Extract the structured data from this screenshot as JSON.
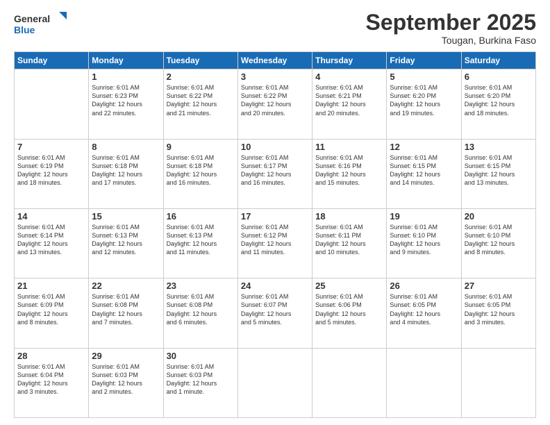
{
  "header": {
    "logo_line1": "General",
    "logo_line2": "Blue",
    "month": "September 2025",
    "location": "Tougan, Burkina Faso"
  },
  "weekdays": [
    "Sunday",
    "Monday",
    "Tuesday",
    "Wednesday",
    "Thursday",
    "Friday",
    "Saturday"
  ],
  "weeks": [
    [
      {
        "day": "",
        "info": ""
      },
      {
        "day": "1",
        "info": "Sunrise: 6:01 AM\nSunset: 6:23 PM\nDaylight: 12 hours\nand 22 minutes."
      },
      {
        "day": "2",
        "info": "Sunrise: 6:01 AM\nSunset: 6:22 PM\nDaylight: 12 hours\nand 21 minutes."
      },
      {
        "day": "3",
        "info": "Sunrise: 6:01 AM\nSunset: 6:22 PM\nDaylight: 12 hours\nand 20 minutes."
      },
      {
        "day": "4",
        "info": "Sunrise: 6:01 AM\nSunset: 6:21 PM\nDaylight: 12 hours\nand 20 minutes."
      },
      {
        "day": "5",
        "info": "Sunrise: 6:01 AM\nSunset: 6:20 PM\nDaylight: 12 hours\nand 19 minutes."
      },
      {
        "day": "6",
        "info": "Sunrise: 6:01 AM\nSunset: 6:20 PM\nDaylight: 12 hours\nand 18 minutes."
      }
    ],
    [
      {
        "day": "7",
        "info": "Sunrise: 6:01 AM\nSunset: 6:19 PM\nDaylight: 12 hours\nand 18 minutes."
      },
      {
        "day": "8",
        "info": "Sunrise: 6:01 AM\nSunset: 6:18 PM\nDaylight: 12 hours\nand 17 minutes."
      },
      {
        "day": "9",
        "info": "Sunrise: 6:01 AM\nSunset: 6:18 PM\nDaylight: 12 hours\nand 16 minutes."
      },
      {
        "day": "10",
        "info": "Sunrise: 6:01 AM\nSunset: 6:17 PM\nDaylight: 12 hours\nand 16 minutes."
      },
      {
        "day": "11",
        "info": "Sunrise: 6:01 AM\nSunset: 6:16 PM\nDaylight: 12 hours\nand 15 minutes."
      },
      {
        "day": "12",
        "info": "Sunrise: 6:01 AM\nSunset: 6:15 PM\nDaylight: 12 hours\nand 14 minutes."
      },
      {
        "day": "13",
        "info": "Sunrise: 6:01 AM\nSunset: 6:15 PM\nDaylight: 12 hours\nand 13 minutes."
      }
    ],
    [
      {
        "day": "14",
        "info": "Sunrise: 6:01 AM\nSunset: 6:14 PM\nDaylight: 12 hours\nand 13 minutes."
      },
      {
        "day": "15",
        "info": "Sunrise: 6:01 AM\nSunset: 6:13 PM\nDaylight: 12 hours\nand 12 minutes."
      },
      {
        "day": "16",
        "info": "Sunrise: 6:01 AM\nSunset: 6:13 PM\nDaylight: 12 hours\nand 11 minutes."
      },
      {
        "day": "17",
        "info": "Sunrise: 6:01 AM\nSunset: 6:12 PM\nDaylight: 12 hours\nand 11 minutes."
      },
      {
        "day": "18",
        "info": "Sunrise: 6:01 AM\nSunset: 6:11 PM\nDaylight: 12 hours\nand 10 minutes."
      },
      {
        "day": "19",
        "info": "Sunrise: 6:01 AM\nSunset: 6:10 PM\nDaylight: 12 hours\nand 9 minutes."
      },
      {
        "day": "20",
        "info": "Sunrise: 6:01 AM\nSunset: 6:10 PM\nDaylight: 12 hours\nand 8 minutes."
      }
    ],
    [
      {
        "day": "21",
        "info": "Sunrise: 6:01 AM\nSunset: 6:09 PM\nDaylight: 12 hours\nand 8 minutes."
      },
      {
        "day": "22",
        "info": "Sunrise: 6:01 AM\nSunset: 6:08 PM\nDaylight: 12 hours\nand 7 minutes."
      },
      {
        "day": "23",
        "info": "Sunrise: 6:01 AM\nSunset: 6:08 PM\nDaylight: 12 hours\nand 6 minutes."
      },
      {
        "day": "24",
        "info": "Sunrise: 6:01 AM\nSunset: 6:07 PM\nDaylight: 12 hours\nand 5 minutes."
      },
      {
        "day": "25",
        "info": "Sunrise: 6:01 AM\nSunset: 6:06 PM\nDaylight: 12 hours\nand 5 minutes."
      },
      {
        "day": "26",
        "info": "Sunrise: 6:01 AM\nSunset: 6:05 PM\nDaylight: 12 hours\nand 4 minutes."
      },
      {
        "day": "27",
        "info": "Sunrise: 6:01 AM\nSunset: 6:05 PM\nDaylight: 12 hours\nand 3 minutes."
      }
    ],
    [
      {
        "day": "28",
        "info": "Sunrise: 6:01 AM\nSunset: 6:04 PM\nDaylight: 12 hours\nand 3 minutes."
      },
      {
        "day": "29",
        "info": "Sunrise: 6:01 AM\nSunset: 6:03 PM\nDaylight: 12 hours\nand 2 minutes."
      },
      {
        "day": "30",
        "info": "Sunrise: 6:01 AM\nSunset: 6:03 PM\nDaylight: 12 hours\nand 1 minute."
      },
      {
        "day": "",
        "info": ""
      },
      {
        "day": "",
        "info": ""
      },
      {
        "day": "",
        "info": ""
      },
      {
        "day": "",
        "info": ""
      }
    ]
  ]
}
